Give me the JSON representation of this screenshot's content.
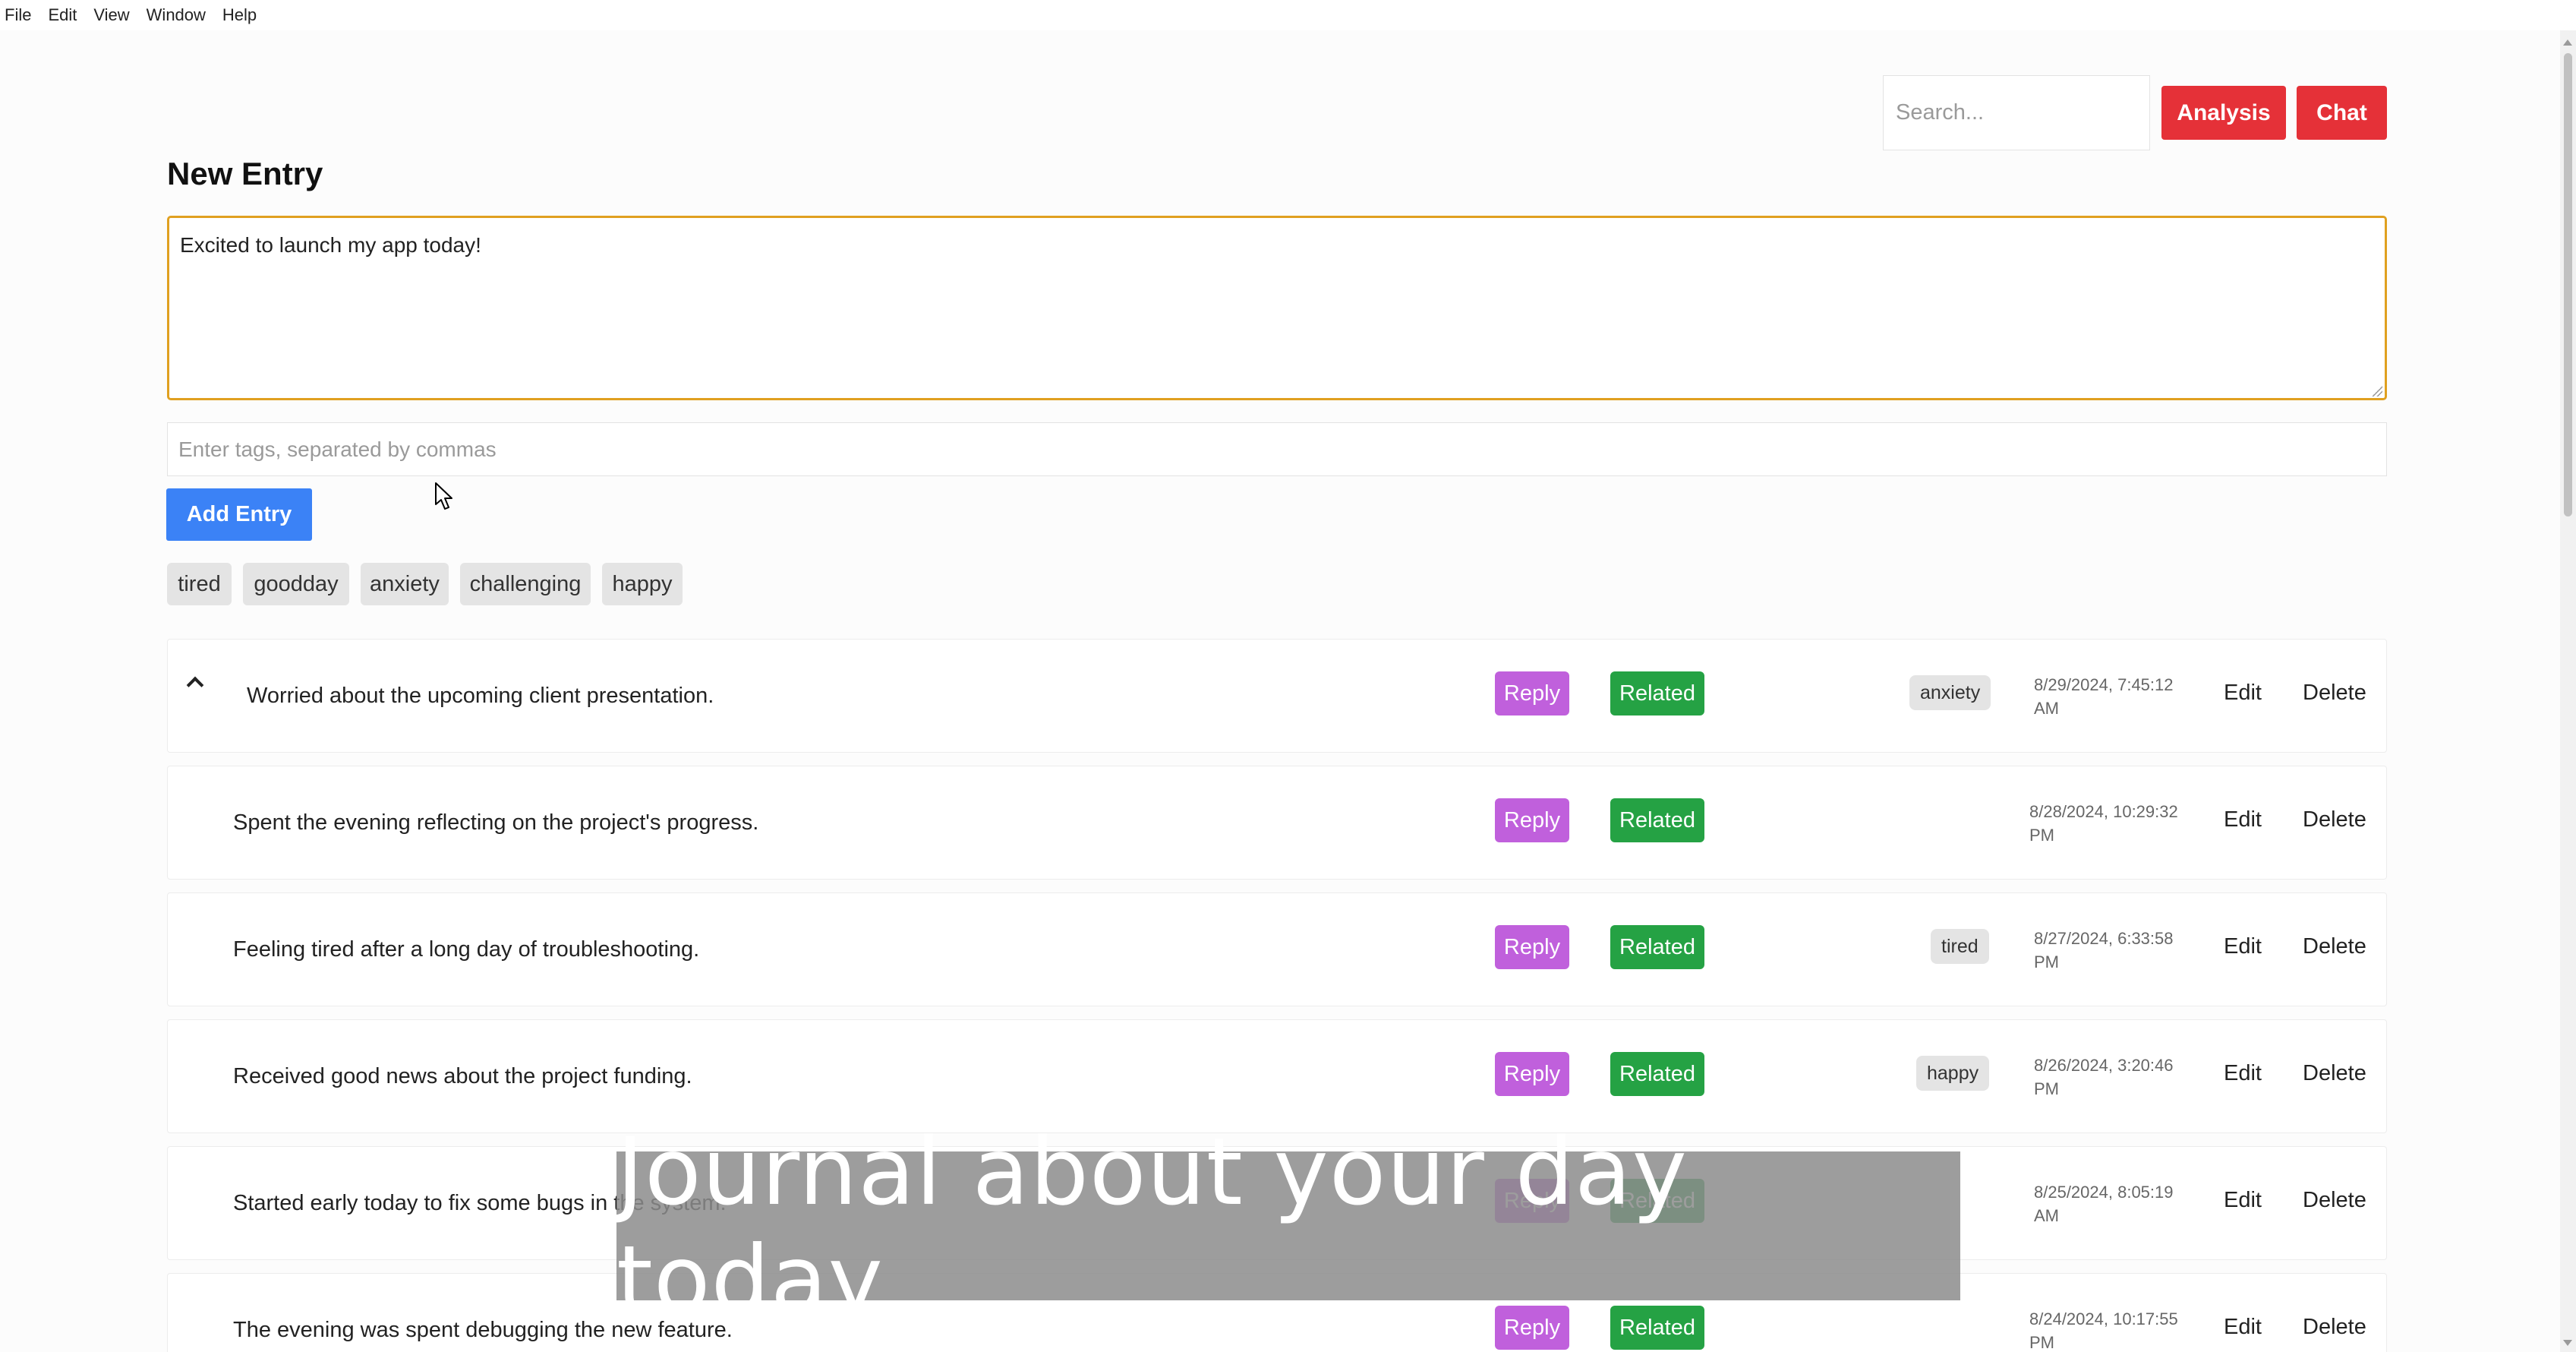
{
  "menubar": {
    "items": [
      "File",
      "Edit",
      "View",
      "Window",
      "Help"
    ]
  },
  "header": {
    "search_placeholder": "Search...",
    "analysis_label": "Analysis",
    "chat_label": "Chat"
  },
  "form": {
    "title": "New Entry",
    "entry_value": "Excited to launch my app today!",
    "tags_placeholder": "Enter tags, separated by commas",
    "add_label": "Add Entry"
  },
  "tag_filters": [
    "tired",
    "goodday",
    "anxiety",
    "challenging",
    "happy"
  ],
  "entries": [
    {
      "text": "Worried about the upcoming client presentation.",
      "tag": "anxiety",
      "date_line1": "8/29/2024, 7:45:12",
      "date_line2": "AM",
      "expanded": true
    },
    {
      "text": "Spent the evening reflecting on the project's progress.",
      "tag": "",
      "date_line1": "8/28/2024, 10:29:32",
      "date_line2": "PM"
    },
    {
      "text": "Feeling tired after a long day of troubleshooting.",
      "tag": "tired",
      "date_line1": "8/27/2024, 6:33:58",
      "date_line2": "PM"
    },
    {
      "text": "Received good news about the project funding.",
      "tag": "happy",
      "date_line1": "8/26/2024, 3:20:46",
      "date_line2": "PM"
    },
    {
      "text": "Started early today to fix some bugs in the system.",
      "tag": "",
      "date_line1": "8/25/2024, 8:05:19",
      "date_line2": "AM"
    },
    {
      "text": "The evening was spent debugging the new feature.",
      "tag": "",
      "date_line1": "8/24/2024, 10:17:55",
      "date_line2": "PM"
    }
  ],
  "entry_actions": {
    "reply": "Reply",
    "related": "Related",
    "edit": "Edit",
    "delete": "Delete"
  },
  "overlay": {
    "caption": "Journal about your day today"
  }
}
